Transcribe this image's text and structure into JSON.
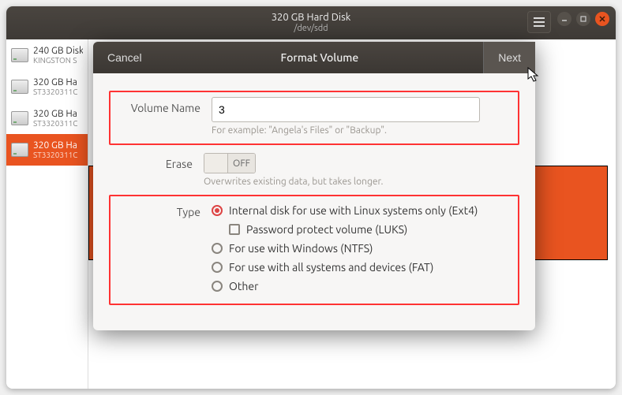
{
  "window": {
    "title": "320 GB Hard Disk",
    "subtitle": "/dev/sdd"
  },
  "sidebar": {
    "items": [
      {
        "label": "240 GB Disk",
        "sub": "KINGSTON S"
      },
      {
        "label": "320 GB Ha",
        "sub": "ST3320311C"
      },
      {
        "label": "320 GB Ha",
        "sub": "ST3320311C"
      },
      {
        "label": "320 GB Ha",
        "sub": "ST3320311C"
      }
    ],
    "selected_index": 3
  },
  "dialog": {
    "cancel_label": "Cancel",
    "title": "Format Volume",
    "next_label": "Next",
    "volume_name_label": "Volume Name",
    "volume_name_value": "3",
    "volume_name_hint": "For example: \"Angela's Files\" or \"Backup\".",
    "erase_label": "Erase",
    "erase_state": "OFF",
    "erase_hint": "Overwrites existing data, but takes longer.",
    "type_label": "Type",
    "type_options": {
      "ext4": "Internal disk for use with Linux systems only (Ext4)",
      "luks": "Password protect volume (LUKS)",
      "ntfs": "For use with Windows (NTFS)",
      "fat": "For use with all systems and devices (FAT)",
      "other": "Other"
    },
    "type_selected": "ext4"
  }
}
